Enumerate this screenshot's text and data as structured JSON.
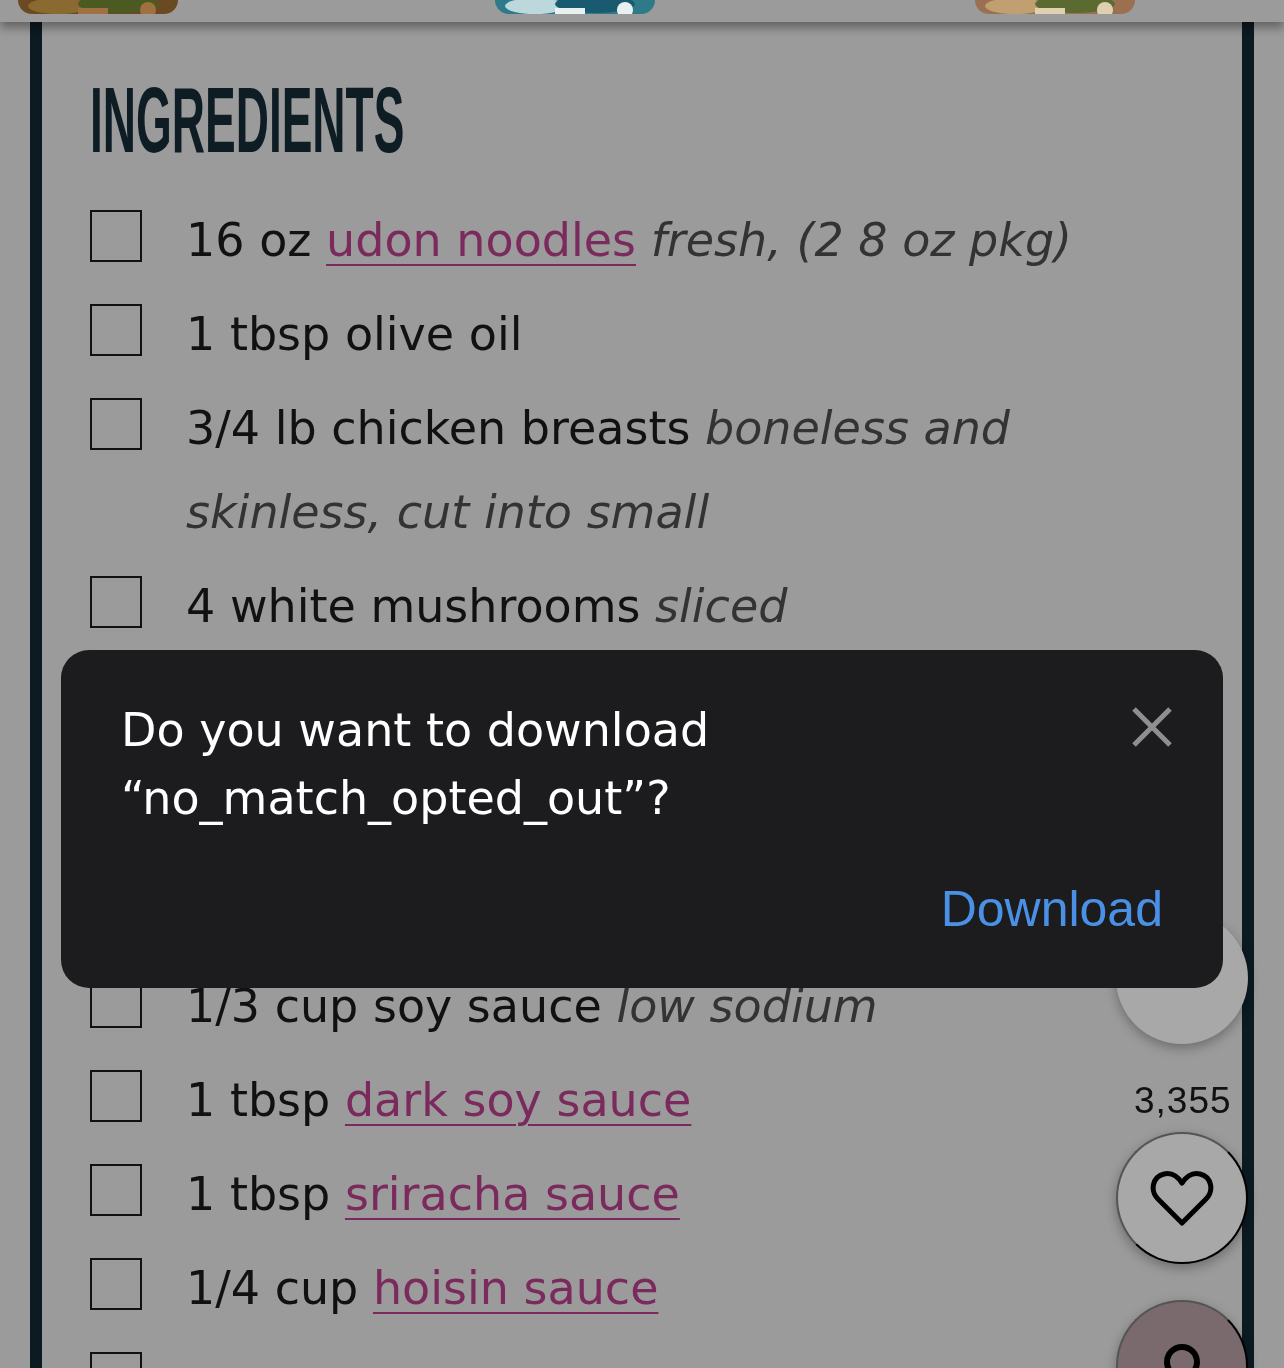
{
  "ingredients": {
    "title": "INGREDIENTS",
    "items": [
      {
        "checked": false,
        "text": "16 oz",
        "link": "udon noodles",
        "notes": "fresh, (2 8 oz pkg)"
      },
      {
        "checked": false,
        "text": "1 tbsp olive oil"
      },
      {
        "checked": false,
        "text": "3/4 lb chicken breasts",
        "notes": "boneless and skinless, cut into small"
      },
      {
        "checked": false,
        "text": "4 white mushrooms",
        "notes": "sliced"
      },
      {
        "checked": false,
        "text": "1/3 cup soy sauce",
        "notes": "low sodium"
      },
      {
        "checked": false,
        "text": "1 tbsp",
        "link": "dark soy sauce"
      },
      {
        "checked": false,
        "text": "1 tbsp",
        "link": "sriracha sauce"
      },
      {
        "checked": false,
        "text": "1/4 cup",
        "link": "hoisin sauce"
      },
      {
        "checked": false
      }
    ]
  },
  "floating": {
    "count": "3,355"
  },
  "dialog": {
    "message": "Do you want to download “no_match_opted_out”?",
    "button": "Download"
  }
}
